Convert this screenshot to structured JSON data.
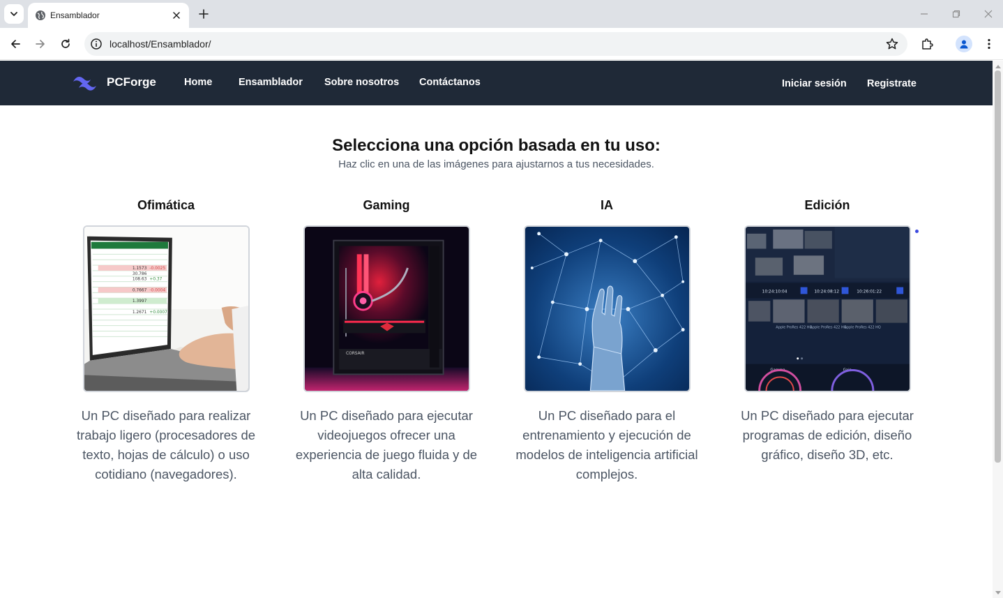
{
  "browser": {
    "tab_title": "Ensamblador",
    "url": "localhost/Ensamblador/"
  },
  "nav": {
    "brand": "PCForge",
    "links": [
      "Home",
      "Ensamblador",
      "Sobre nosotros",
      "Contáctanos"
    ],
    "login": "Iniciar sesión",
    "register": "Registrate"
  },
  "main": {
    "title": "Selecciona una opción basada en tu uso:",
    "subtitle": "Haz clic en una de las imágenes para ajustarnos a tus necesidades.",
    "options": [
      {
        "title": "Ofimática",
        "description": "Un PC diseñado para realizar trabajo ligero (procesadores de texto, hojas de cálculo) o uso cotidiano (navegadores)."
      },
      {
        "title": "Gaming",
        "description": "Un PC diseñado para ejecutar videojuegos ofrecer una experiencia de juego fluida y de alta calidad."
      },
      {
        "title": "IA",
        "description": "Un PC diseñado para el entrenamiento y ejecución de modelos de inteligencia artificial complejos."
      },
      {
        "title": "Edición",
        "description": "Un PC diseñado para ejecutar programas de edición, diseño gráfico, diseño 3D, etc."
      }
    ]
  },
  "colors": {
    "nav_bg": "#1f2937",
    "brand_accent": "#6366f1"
  }
}
